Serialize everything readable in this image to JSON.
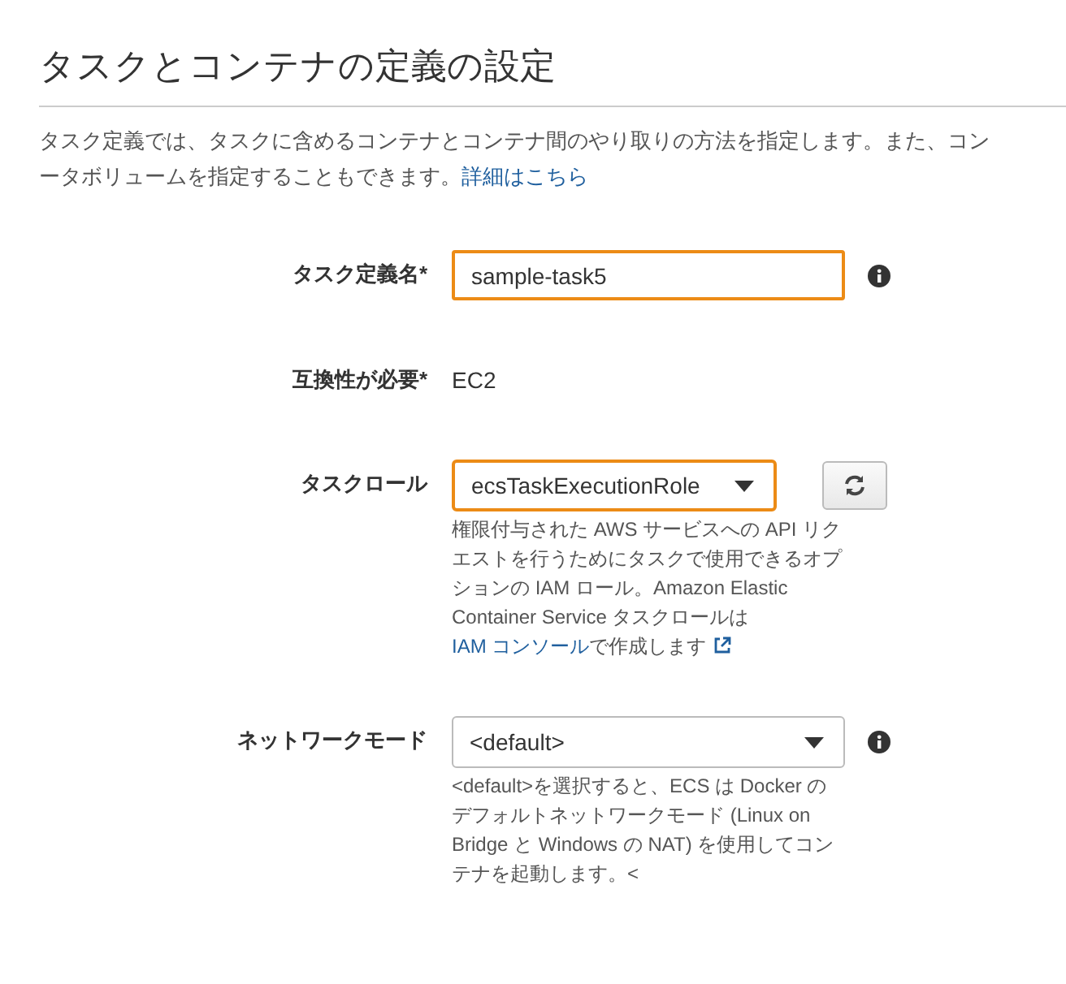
{
  "section": {
    "title": "タスクとコンテナの定義の設定",
    "description_lines": [
      "タスク定義では、タスクに含めるコンテナとコンテナ間のやり取りの方法を指定します。また、コン",
      "ータボリュームを指定することもできます。"
    ],
    "description_link": "詳細はこちら"
  },
  "fields": [
    {
      "kind": "text",
      "label": "タスク定義名*",
      "value": "sample-task5",
      "highlighted": true,
      "info": true
    },
    {
      "kind": "static",
      "label": "互換性が必要*",
      "value": "EC2"
    },
    {
      "kind": "select",
      "label": "タスクロール",
      "value": "ecsTaskExecutionRole",
      "highlighted": true,
      "info": false,
      "refresh": true,
      "narrow": true,
      "help": "権限付与された AWS サービスへの API リクエストを行うためにタスクで使用できるオプションの IAM ロール。Amazon Elastic Container Service タスクロールは ",
      "help_link": "IAM コンソール",
      "help_after": "で作成します",
      "external_link": true
    },
    {
      "kind": "select",
      "label": "ネットワークモード",
      "value": "<default>",
      "highlighted": false,
      "info": true,
      "refresh": false,
      "narrow": false,
      "help": "<default>を選択すると、ECS は Docker のデフォルトネットワークモード (Linux on Bridge と Windows の NAT) を使用してコンテナを起動します。<"
    }
  ]
}
